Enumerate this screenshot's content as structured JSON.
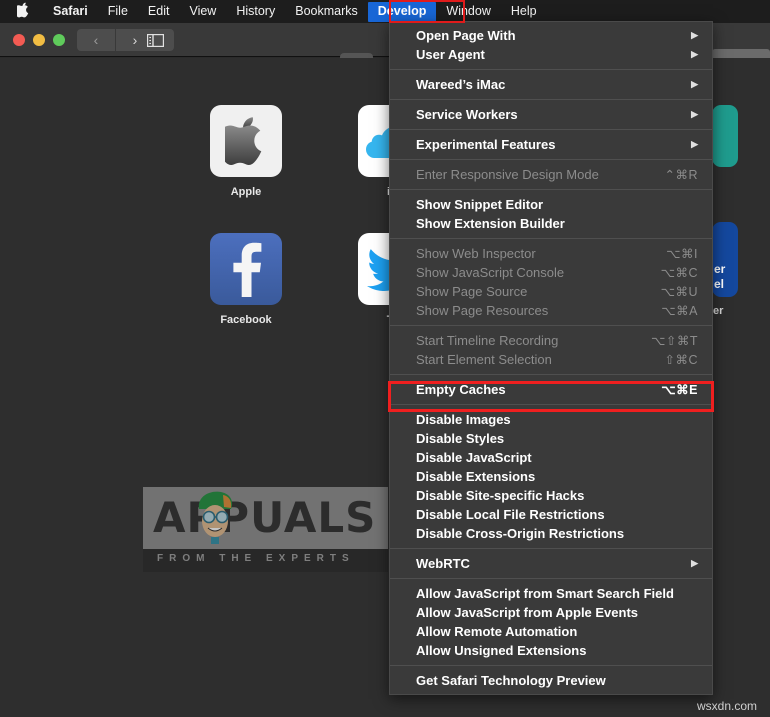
{
  "menubar": {
    "apple_logo": "",
    "items": [
      {
        "label": "Safari",
        "bold": true,
        "active": false
      },
      {
        "label": "File",
        "bold": false,
        "active": false
      },
      {
        "label": "Edit",
        "bold": false,
        "active": false
      },
      {
        "label": "View",
        "bold": false,
        "active": false
      },
      {
        "label": "History",
        "bold": false,
        "active": false
      },
      {
        "label": "Bookmarks",
        "bold": false,
        "active": false
      },
      {
        "label": "Develop",
        "bold": true,
        "active": true
      },
      {
        "label": "Window",
        "bold": false,
        "active": false
      },
      {
        "label": "Help",
        "bold": false,
        "active": false
      }
    ]
  },
  "toolbar": {
    "back_glyph": "‹",
    "forward_glyph": "›",
    "sidebar_icon": "sidebar-icon"
  },
  "favorites": [
    {
      "name": "Apple",
      "label": "Apple"
    },
    {
      "name": "iCloud",
      "label": "iCl"
    },
    {
      "name": "Facebook",
      "label": "Facebook"
    },
    {
      "name": "Twitter",
      "label": "Tw"
    }
  ],
  "edge_tiles": {
    "blue_text_line1": "er",
    "blue_text_line2": "el",
    "blue_label": "er"
  },
  "develop_menu": {
    "sections": [
      {
        "items": [
          {
            "label": "Open Page With",
            "submenu": true,
            "shortcut": "",
            "disabled": false
          },
          {
            "label": "User Agent",
            "submenu": true,
            "shortcut": "",
            "disabled": false
          }
        ]
      },
      {
        "items": [
          {
            "label": "Wareed’s iMac",
            "submenu": true,
            "shortcut": "",
            "disabled": false
          }
        ]
      },
      {
        "items": [
          {
            "label": "Service Workers",
            "submenu": true,
            "shortcut": "",
            "disabled": false
          }
        ]
      },
      {
        "items": [
          {
            "label": "Experimental Features",
            "submenu": true,
            "shortcut": "",
            "disabled": false
          }
        ]
      },
      {
        "items": [
          {
            "label": "Enter Responsive Design Mode",
            "submenu": false,
            "shortcut": "⌃⌘R",
            "disabled": true
          }
        ]
      },
      {
        "items": [
          {
            "label": "Show Snippet Editor",
            "submenu": false,
            "shortcut": "",
            "disabled": false
          },
          {
            "label": "Show Extension Builder",
            "submenu": false,
            "shortcut": "",
            "disabled": false
          }
        ]
      },
      {
        "items": [
          {
            "label": "Show Web Inspector",
            "submenu": false,
            "shortcut": "⌥⌘I",
            "disabled": true
          },
          {
            "label": "Show JavaScript Console",
            "submenu": false,
            "shortcut": "⌥⌘C",
            "disabled": true
          },
          {
            "label": "Show Page Source",
            "submenu": false,
            "shortcut": "⌥⌘U",
            "disabled": true
          },
          {
            "label": "Show Page Resources",
            "submenu": false,
            "shortcut": "⌥⌘A",
            "disabled": true
          }
        ]
      },
      {
        "items": [
          {
            "label": "Start Timeline Recording",
            "submenu": false,
            "shortcut": "⌥⇧⌘T",
            "disabled": true
          },
          {
            "label": "Start Element Selection",
            "submenu": false,
            "shortcut": "⇧⌘C",
            "disabled": true
          }
        ]
      },
      {
        "items": [
          {
            "label": "Empty Caches",
            "submenu": false,
            "shortcut": "⌥⌘E",
            "disabled": false,
            "highlighted": true
          }
        ]
      },
      {
        "items": [
          {
            "label": "Disable Images",
            "submenu": false,
            "shortcut": "",
            "disabled": false
          },
          {
            "label": "Disable Styles",
            "submenu": false,
            "shortcut": "",
            "disabled": false
          },
          {
            "label": "Disable JavaScript",
            "submenu": false,
            "shortcut": "",
            "disabled": false
          },
          {
            "label": "Disable Extensions",
            "submenu": false,
            "shortcut": "",
            "disabled": false
          },
          {
            "label": "Disable Site-specific Hacks",
            "submenu": false,
            "shortcut": "",
            "disabled": false
          },
          {
            "label": "Disable Local File Restrictions",
            "submenu": false,
            "shortcut": "",
            "disabled": false
          },
          {
            "label": "Disable Cross-Origin Restrictions",
            "submenu": false,
            "shortcut": "",
            "disabled": false
          }
        ]
      },
      {
        "items": [
          {
            "label": "WebRTC",
            "submenu": true,
            "shortcut": "",
            "disabled": false
          }
        ]
      },
      {
        "items": [
          {
            "label": "Allow JavaScript from Smart Search Field",
            "submenu": false,
            "shortcut": "",
            "disabled": false
          },
          {
            "label": "Allow JavaScript from Apple Events",
            "submenu": false,
            "shortcut": "",
            "disabled": false
          },
          {
            "label": "Allow Remote Automation",
            "submenu": false,
            "shortcut": "",
            "disabled": false
          },
          {
            "label": "Allow Unsigned Extensions",
            "submenu": false,
            "shortcut": "",
            "disabled": false
          }
        ]
      },
      {
        "items": [
          {
            "label": "Get Safari Technology Preview",
            "submenu": false,
            "shortcut": "",
            "disabled": false
          }
        ]
      }
    ]
  },
  "watermark": {
    "brand": "APPUALS",
    "tagline": "FROM  THE  EXPERTS",
    "corner": "wsxdn.com"
  },
  "colors": {
    "menubar_bg": "#1d1d1d",
    "menu_bg": "#3a3a3a",
    "accent_blue": "#1866d6",
    "highlight_red": "#ef1f1f",
    "facebook_blue": "#4c6fbe",
    "twitter_blue": "#1da1f2"
  }
}
